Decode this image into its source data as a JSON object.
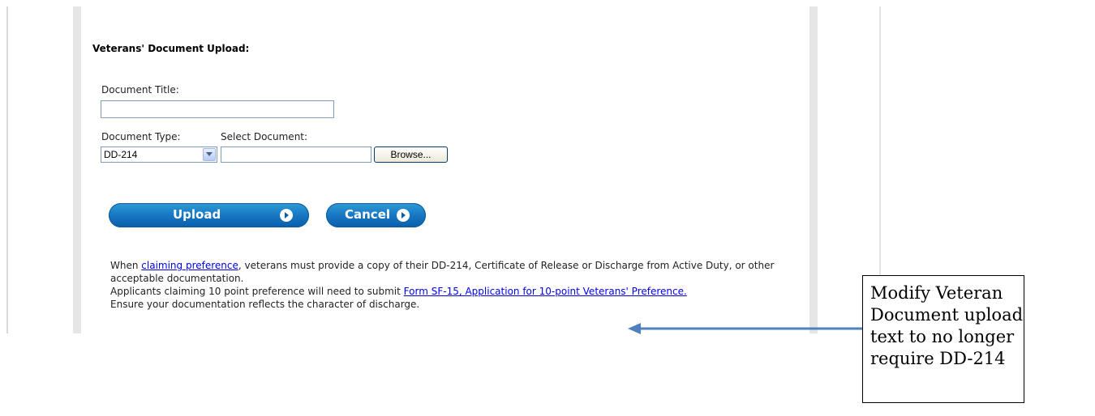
{
  "form": {
    "title": "Veterans' Document Upload:",
    "document_title_label": "Document Title:",
    "document_title_value": "",
    "document_type_label": "Document Type:",
    "document_type_value": "DD-214",
    "select_document_label": "Select Document:",
    "select_document_value": "",
    "browse_label": "Browse...",
    "upload_label": "Upload",
    "cancel_label": "Cancel"
  },
  "info": {
    "p1_before": "When ",
    "claiming_link": "claiming preference",
    "p1_after": ", veterans must provide a copy of their DD-214, Certificate of Release or Discharge from Active Duty, or other acceptable documentation.",
    "p2_before": "Applicants claiming 10 point preference will need to submit ",
    "sf15_link": "Form SF-15, Application for 10-point Veterans' Preference.",
    "p3": "Ensure your documentation reflects the character of discharge."
  },
  "annotation": {
    "note_text": "Modify Veteran Document upload text to no longer require DD-214",
    "arrow_color": "#4f81bd"
  },
  "colors": {
    "button_blue": "#1777c3",
    "link_blue": "#0000ee"
  },
  "icons": {
    "dropdown": "chevron-down-icon",
    "button_arrow": "play-arrow-icon"
  }
}
